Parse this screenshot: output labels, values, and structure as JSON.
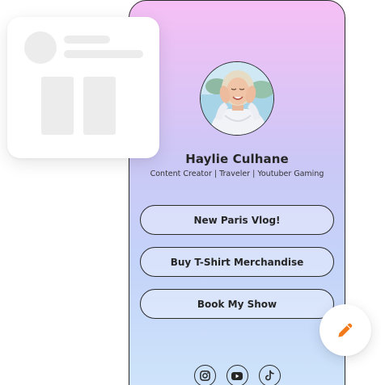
{
  "profile": {
    "name": "Haylie Culhane",
    "bio": "Content Creator | Traveler | Youtuber Gaming"
  },
  "links": [
    {
      "label": "New Paris Vlog!"
    },
    {
      "label": "Buy T-Shirt Merchandise"
    },
    {
      "label": "Book My Show"
    }
  ],
  "socials": [
    {
      "icon": "instagram-icon"
    },
    {
      "icon": "youtube-icon"
    },
    {
      "icon": "tiktok-icon"
    }
  ],
  "colors": {
    "gradient_top": "#f6bff5",
    "gradient_bottom": "#cfe6fb",
    "edit_accent": "#f27a1a"
  },
  "icons": {
    "edit": "pencil-icon",
    "template": "layout-template-icon"
  }
}
